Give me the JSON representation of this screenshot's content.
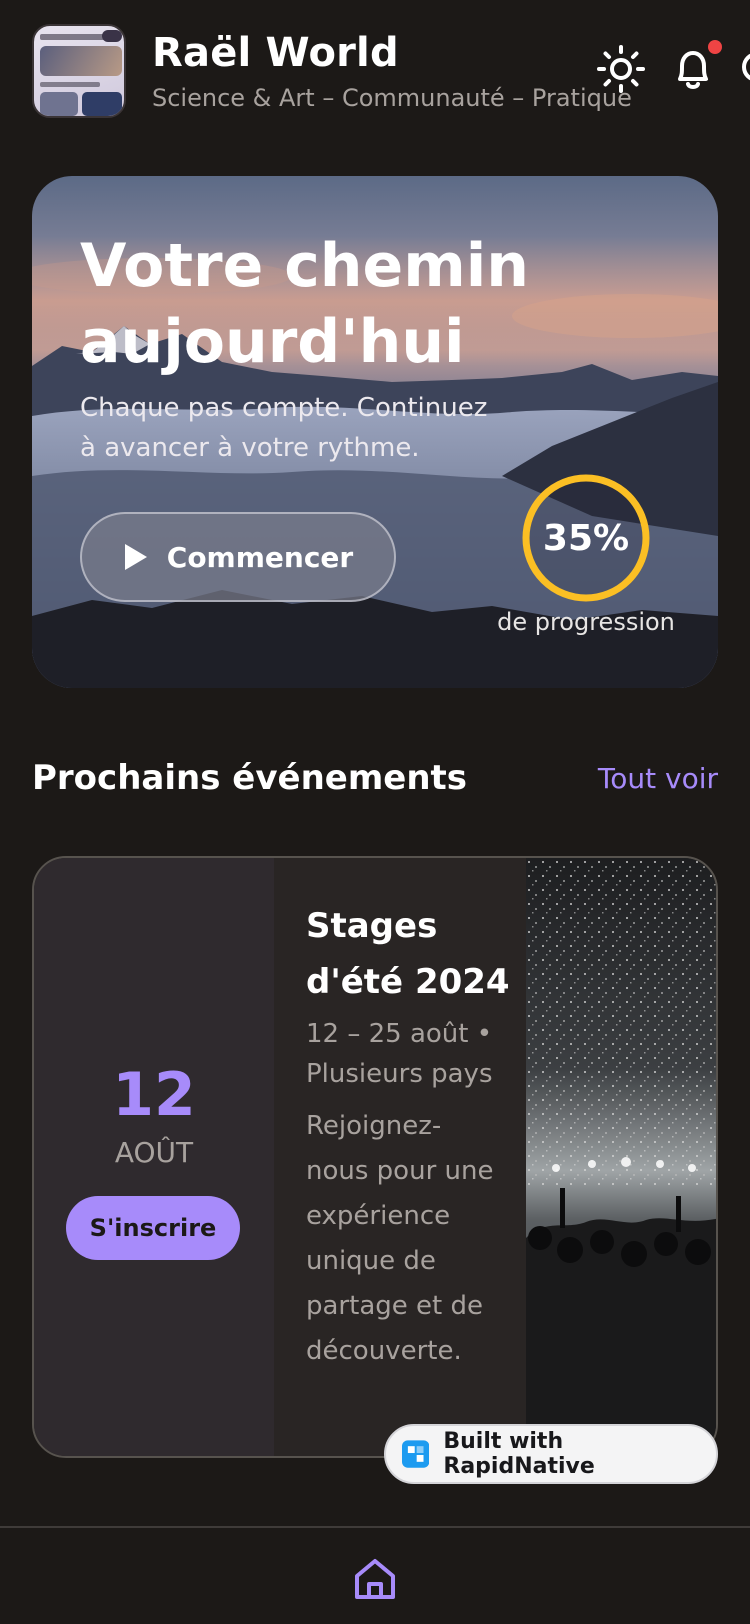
{
  "header": {
    "title": "Raël World",
    "subtitle": "Science & Art – Communauté – Pratique",
    "icons": [
      "app-icon",
      "sun-icon",
      "bell-icon"
    ]
  },
  "hero": {
    "title": "Votre chemin aujourd'hui",
    "subtitle": "Chaque pas compte. Continuez à avancer à votre rythme.",
    "button_label": "Commencer",
    "progress_text": "35%",
    "progress_fraction": 0.35,
    "progress_label": "de progression",
    "progress_color": "#fbbf24"
  },
  "events": {
    "section_title": "Prochains événements",
    "see_all": "Tout voir",
    "items": [
      {
        "day": "12",
        "month": "AOÛT",
        "register_label": "S'inscrire",
        "title": "Stages d'été 2024",
        "meta": "12 – 25 août • Plusieurs pays",
        "description": "Rejoignez-nous pour une expérience unique de partage et de découverte."
      }
    ]
  },
  "badge": {
    "label": "Built with RapidNative"
  },
  "nav": {
    "active": "home-icon"
  },
  "colors": {
    "accent": "#a78bfa",
    "background": "#1c1917",
    "notification": "#ef4444"
  }
}
